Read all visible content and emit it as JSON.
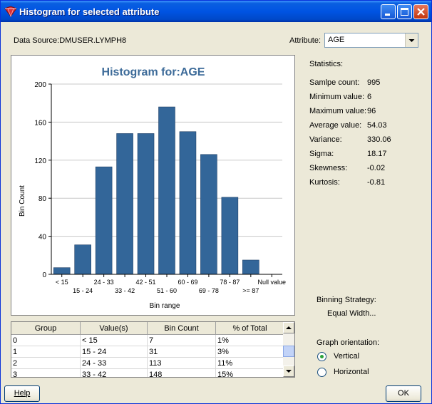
{
  "window": {
    "title": "Histogram for selected attribute"
  },
  "header": {
    "data_source": "Data Source:DMUSER.LYMPH8",
    "attribute_label": "Attribute:",
    "attribute_value": "AGE"
  },
  "chart_data": {
    "type": "bar",
    "title": "Histogram for:AGE",
    "xlabel": "Bin range",
    "ylabel": "Bin Count",
    "ylim": [
      0,
      200
    ],
    "yticks": [
      0,
      40,
      80,
      120,
      160,
      200
    ],
    "categories": [
      "< 15",
      "15 - 24",
      "24 - 33",
      "33 - 42",
      "42 - 51",
      "51 - 60",
      "60 - 69",
      "69 - 78",
      "78 - 87",
      ">= 87",
      "Null value"
    ],
    "values": [
      7,
      31,
      113,
      148,
      148,
      176,
      150,
      126,
      81,
      15,
      0
    ],
    "color": "#336699",
    "grid": true
  },
  "table": {
    "columns": [
      "Group",
      "Value(s)",
      "Bin Count",
      "% of Total"
    ],
    "rows": [
      [
        "0",
        "< 15",
        "7",
        "1%"
      ],
      [
        "1",
        "15 - 24",
        "31",
        "3%"
      ],
      [
        "2",
        "24 - 33",
        "113",
        "11%"
      ],
      [
        "3",
        "33 - 42",
        "148",
        "15%"
      ]
    ]
  },
  "statistics": {
    "heading": "Statistics:",
    "items": [
      {
        "label": "Samlpe count:",
        "value": "995"
      },
      {
        "label": "Minimum value:",
        "value": "6"
      },
      {
        "label": "Maximum value:",
        "value": "96"
      },
      {
        "label": "Average value:",
        "value": "54.03"
      },
      {
        "label": "Variance:",
        "value": "330.06"
      },
      {
        "label": "Sigma:",
        "value": "18.17"
      },
      {
        "label": "Skewness:",
        "value": "-0.02"
      },
      {
        "label": "Kurtosis:",
        "value": "-0.81"
      }
    ]
  },
  "binning": {
    "label": "Binning Strategy:",
    "value": "Equal Width..."
  },
  "orientation": {
    "label": "Graph orientation:",
    "vertical": "Vertical",
    "horizontal": "Horizontal",
    "selected": "Vertical"
  },
  "buttons": {
    "help": "Help",
    "ok": "OK"
  },
  "colors": {
    "titlebar": "#0054e3",
    "dialog_bg": "#ece9d8",
    "bar": "#336699",
    "chart_title": "#3d6b99"
  }
}
